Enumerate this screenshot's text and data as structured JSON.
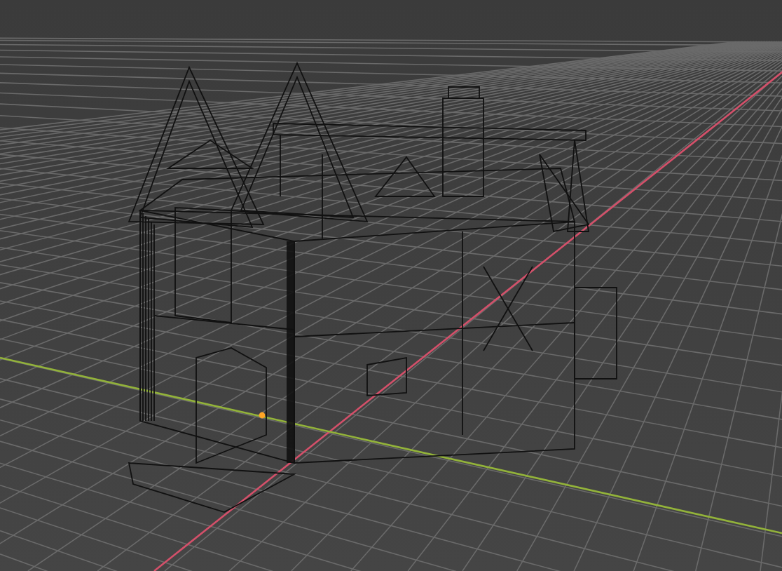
{
  "viewport": {
    "axes": [
      {
        "kind": "x",
        "color": "#d4506a"
      },
      {
        "kind": "y",
        "color": "#93b33a"
      }
    ]
  }
}
